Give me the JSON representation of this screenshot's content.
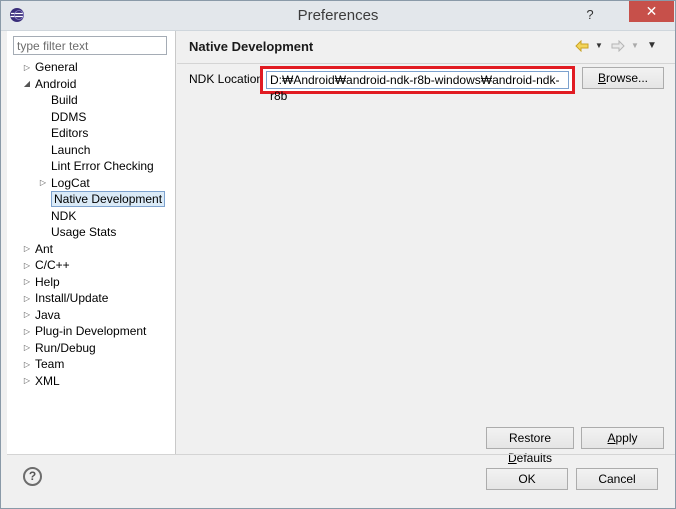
{
  "window": {
    "title": "Preferences",
    "help_glyph": "?",
    "close_glyph": "✕"
  },
  "filter": {
    "placeholder": "type filter text",
    "value": ""
  },
  "tree": [
    {
      "label": "General",
      "expander": "collapsed",
      "level": 0
    },
    {
      "label": "Android",
      "expander": "expanded",
      "level": 0
    },
    {
      "label": "Build",
      "expander": "none",
      "level": 1
    },
    {
      "label": "DDMS",
      "expander": "none",
      "level": 1
    },
    {
      "label": "Editors",
      "expander": "none",
      "level": 1
    },
    {
      "label": "Launch",
      "expander": "none",
      "level": 1
    },
    {
      "label": "Lint Error Checking",
      "expander": "none",
      "level": 1
    },
    {
      "label": "LogCat",
      "expander": "collapsed",
      "level": 1
    },
    {
      "label": "Native Development",
      "expander": "none",
      "level": 1,
      "selected": true
    },
    {
      "label": "NDK",
      "expander": "none",
      "level": 1
    },
    {
      "label": "Usage Stats",
      "expander": "none",
      "level": 1
    },
    {
      "label": "Ant",
      "expander": "collapsed",
      "level": 0
    },
    {
      "label": "C/C++",
      "expander": "collapsed",
      "level": 0
    },
    {
      "label": "Help",
      "expander": "collapsed",
      "level": 0
    },
    {
      "label": "Install/Update",
      "expander": "collapsed",
      "level": 0
    },
    {
      "label": "Java",
      "expander": "collapsed",
      "level": 0
    },
    {
      "label": "Plug-in Development",
      "expander": "collapsed",
      "level": 0
    },
    {
      "label": "Run/Debug",
      "expander": "collapsed",
      "level": 0
    },
    {
      "label": "Team",
      "expander": "collapsed",
      "level": 0
    },
    {
      "label": "XML",
      "expander": "collapsed",
      "level": 0
    }
  ],
  "page": {
    "title": "Native Development",
    "ndk_label": "NDK Location",
    "ndk_value": "D:₩Android₩android-ndk-r8b-windows₩android-ndk-r8b",
    "browse_pre": "",
    "browse_ul": "B",
    "browse_post": "rowse...",
    "restore_pre": "Restore ",
    "restore_ul": "D",
    "restore_post": "efaults",
    "apply_pre": "",
    "apply_ul": "A",
    "apply_post": "pply"
  },
  "footer": {
    "ok_label": "OK",
    "cancel_label": "Cancel",
    "help_glyph": "?"
  },
  "icons": {
    "back": "back-arrow-icon",
    "forward": "forward-arrow-icon",
    "menu": "view-menu-icon"
  },
  "colors": {
    "highlight_box": "#e11b22",
    "selection": "#daeaf7",
    "close_button": "#c7504a",
    "back_arrow": "#e0b020"
  }
}
